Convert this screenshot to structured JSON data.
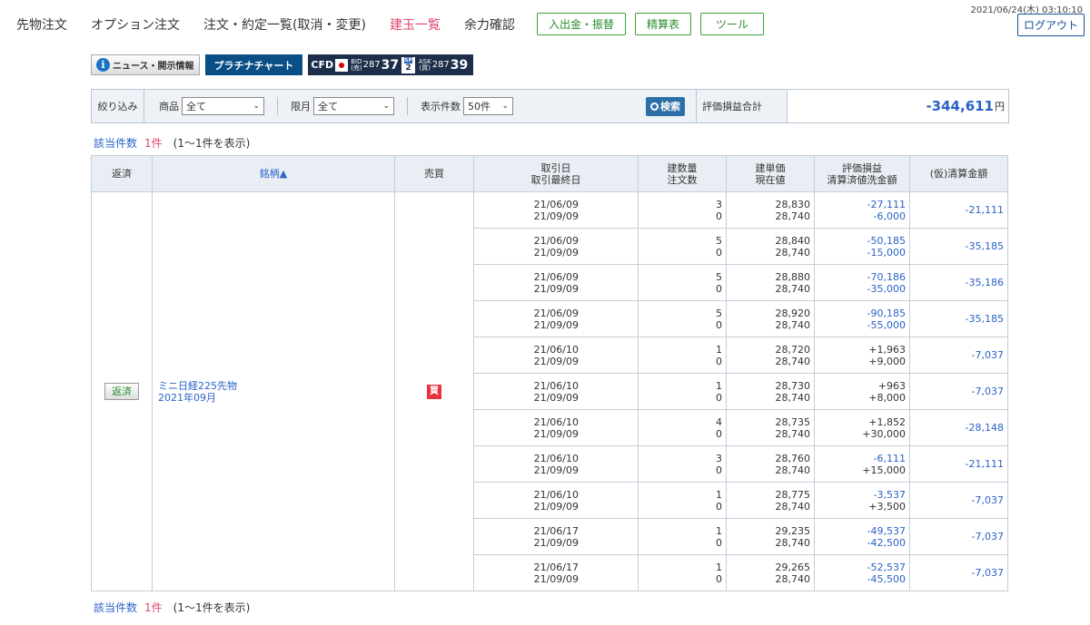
{
  "header": {
    "datetime": "2021/06/24(木) 03:10:10",
    "nav": [
      "先物注文",
      "オプション注文",
      "注文・約定一覧(取消・変更)",
      "建玉一覧",
      "余力確認"
    ],
    "buttons": [
      "入出金・振替",
      "精算表",
      "ツール"
    ],
    "logout": "ログアウト"
  },
  "toolbar": {
    "news": "ニュース・開示情報",
    "platinum": "プラチナチャート",
    "cfd": {
      "label": "CFD",
      "flag_sub": "225",
      "bid_label": "BID",
      "bid_sub": "(売)",
      "bid_main": "287",
      "bid_big": "37",
      "sp_label": "SP",
      "sp_value": "2",
      "ask_label": "ASK",
      "ask_sub": "(買)",
      "ask_main": "287",
      "ask_big": "39"
    }
  },
  "filter": {
    "title": "絞り込み",
    "product_label": "商品",
    "product_value": "全て",
    "month_label": "限月",
    "month_value": "全て",
    "count_label": "表示件数",
    "count_value": "50件",
    "search": "検索",
    "eval_label": "評価損益合計",
    "eval_value": "-344,611",
    "eval_unit": "円"
  },
  "summary": {
    "label": "該当件数",
    "num": "1件",
    "range": "(1〜1件を表示)"
  },
  "table": {
    "headers": {
      "return": "返済",
      "issue": "銘柄▲",
      "side": "売買",
      "date1": "取引日",
      "date2": "取引最終日",
      "qty1": "建数量",
      "qty2": "注文数",
      "price1": "建単価",
      "price2": "現在値",
      "pl1": "評価損益",
      "pl2": "清算済値洗金額",
      "settle": "(仮)清算金額"
    },
    "return_button": "返済",
    "issue_name": "ミニ日経225先物",
    "issue_month": "2021年09月",
    "side_badge": "買",
    "rows": [
      {
        "date": "21/06/09",
        "last": "21/09/09",
        "qty": "3",
        "order": "0",
        "price": "28,830",
        "current": "28,740",
        "pl": "-27,111",
        "wash": "-6,000",
        "settle": "-21,111"
      },
      {
        "date": "21/06/09",
        "last": "21/09/09",
        "qty": "5",
        "order": "0",
        "price": "28,840",
        "current": "28,740",
        "pl": "-50,185",
        "wash": "-15,000",
        "settle": "-35,185"
      },
      {
        "date": "21/06/09",
        "last": "21/09/09",
        "qty": "5",
        "order": "0",
        "price": "28,880",
        "current": "28,740",
        "pl": "-70,186",
        "wash": "-35,000",
        "settle": "-35,186"
      },
      {
        "date": "21/06/09",
        "last": "21/09/09",
        "qty": "5",
        "order": "0",
        "price": "28,920",
        "current": "28,740",
        "pl": "-90,185",
        "wash": "-55,000",
        "settle": "-35,185"
      },
      {
        "date": "21/06/10",
        "last": "21/09/09",
        "qty": "1",
        "order": "0",
        "price": "28,720",
        "current": "28,740",
        "pl": "+1,963",
        "wash": "+9,000",
        "settle": "-7,037"
      },
      {
        "date": "21/06/10",
        "last": "21/09/09",
        "qty": "1",
        "order": "0",
        "price": "28,730",
        "current": "28,740",
        "pl": "+963",
        "wash": "+8,000",
        "settle": "-7,037"
      },
      {
        "date": "21/06/10",
        "last": "21/09/09",
        "qty": "4",
        "order": "0",
        "price": "28,735",
        "current": "28,740",
        "pl": "+1,852",
        "wash": "+30,000",
        "settle": "-28,148"
      },
      {
        "date": "21/06/10",
        "last": "21/09/09",
        "qty": "3",
        "order": "0",
        "price": "28,760",
        "current": "28,740",
        "pl": "-6,111",
        "wash": "+15,000",
        "settle": "-21,111"
      },
      {
        "date": "21/06/10",
        "last": "21/09/09",
        "qty": "1",
        "order": "0",
        "price": "28,775",
        "current": "28,740",
        "pl": "-3,537",
        "wash": "+3,500",
        "settle": "-7,037"
      },
      {
        "date": "21/06/17",
        "last": "21/09/09",
        "qty": "1",
        "order": "0",
        "price": "29,235",
        "current": "28,740",
        "pl": "-49,537",
        "wash": "-42,500",
        "settle": "-7,037"
      },
      {
        "date": "21/06/17",
        "last": "21/09/09",
        "qty": "1",
        "order": "0",
        "price": "29,265",
        "current": "28,740",
        "pl": "-52,537",
        "wash": "-45,500",
        "settle": "-7,037"
      }
    ]
  }
}
